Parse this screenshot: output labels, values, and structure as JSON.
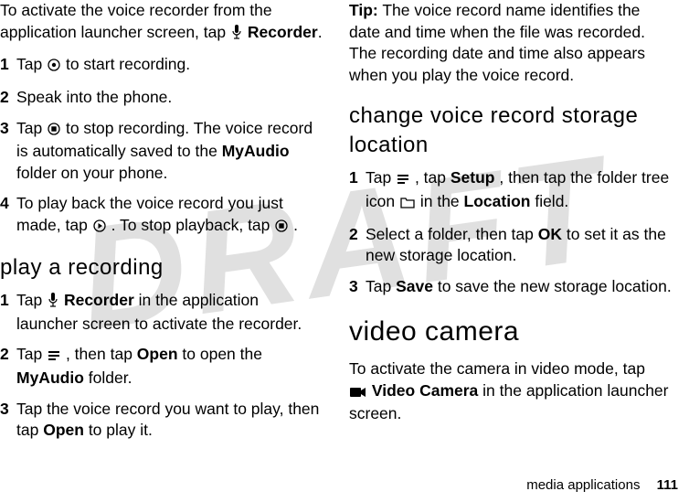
{
  "watermark": "DRAFT",
  "left": {
    "intro_pre": "To activate the voice recorder from the application launcher screen, tap ",
    "intro_label": "Recorder",
    "intro_post": ".",
    "steps": [
      {
        "n": "1",
        "pre": "Tap ",
        "post": " to start recording."
      },
      {
        "n": "2",
        "text": "Speak into the phone."
      },
      {
        "n": "3",
        "pre": "Tap ",
        "mid1": " to stop recording. The voice record is automatically saved to the ",
        "bold1": "MyAudio",
        "post": " folder on your phone."
      },
      {
        "n": "4",
        "pre": "To play back the voice record you just made, tap ",
        "mid": ". To stop playback, tap ",
        "post": "."
      }
    ],
    "heading": "play a recording",
    "psteps": [
      {
        "n": "1",
        "pre": "Tap ",
        "bold1": "Recorder",
        "post": " in the application launcher screen to activate the recorder."
      },
      {
        "n": "2",
        "pre": "Tap ",
        "mid": ", then tap ",
        "bold1": "Open",
        "mid2": " to open the ",
        "bold2": "MyAudio",
        "post": " folder."
      },
      {
        "n": "3",
        "pre": "Tap the voice record you want to play, then tap ",
        "bold1": "Open",
        "post": " to play it."
      }
    ]
  },
  "right": {
    "tip_label": "Tip:",
    "tip_text": " The voice record name identifies the date and time when the file was recorded. The recording date and time also appears when you play the voice record.",
    "heading1": "change voice record storage location",
    "csteps": [
      {
        "n": "1",
        "pre": "Tap ",
        "mid": ", tap ",
        "bold1": "Setup",
        "mid2": ", then tap the folder tree icon ",
        "mid3": " in the ",
        "bold2": "Location",
        "post": " field."
      },
      {
        "n": "2",
        "pre": "Select a folder, then tap ",
        "bold1": "OK",
        "post": " to set it as the new storage location."
      },
      {
        "n": "3",
        "pre": "Tap ",
        "bold1": "Save",
        "post": " to save the new storage location."
      }
    ],
    "heading2": "video camera",
    "video_pre": "To activate the camera in video mode, tap ",
    "video_bold": "Video Camera",
    "video_post": " in the application launcher screen."
  },
  "footer": {
    "section": "media applications",
    "page": "111"
  }
}
